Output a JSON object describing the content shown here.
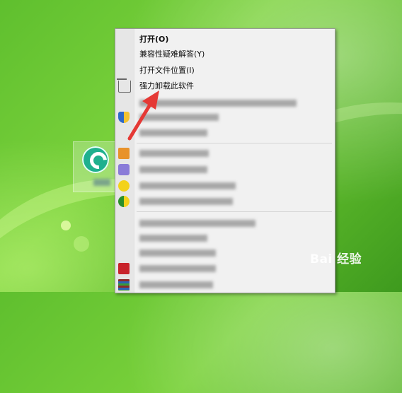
{
  "context_menu": {
    "items": [
      {
        "label": "打开(O)"
      },
      {
        "label": "兼容性疑难解答(Y)"
      },
      {
        "label": "打开文件位置(I)"
      },
      {
        "label": "强力卸载此软件"
      }
    ]
  },
  "watermark": {
    "text": "Bai 经验"
  },
  "colors": {
    "accent_arrow": "#e53935",
    "desktop_green": "#6cc533"
  }
}
